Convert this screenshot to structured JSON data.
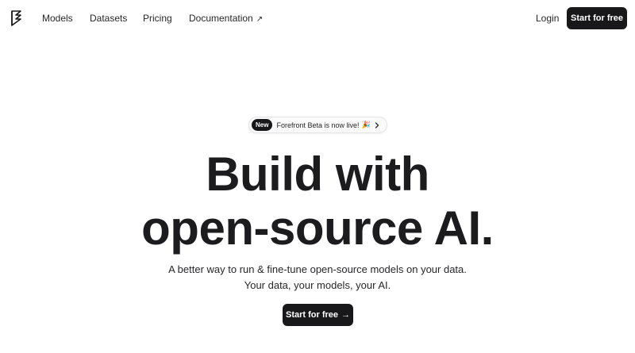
{
  "nav": {
    "links": [
      {
        "label": "Models"
      },
      {
        "label": "Datasets"
      },
      {
        "label": "Pricing"
      },
      {
        "label": "Documentation",
        "external_icon": "arrow-up-right-icon"
      }
    ],
    "login_label": "Login",
    "cta_label": "Start for free"
  },
  "announcement": {
    "badge": "New",
    "text": "Forefront Beta is now live!",
    "emoji": "🎉"
  },
  "hero": {
    "title_line1": "Build with",
    "title_line2": "open-source AI.",
    "subtitle_line1": "A better way to run & fine-tune open-source models on your data.",
    "subtitle_line2": "Your data, your models, your AI.",
    "cta_label": "Start for free",
    "cta_icon": "arrow-right-icon"
  },
  "colors": {
    "primary": "#18181b",
    "background": "#ffffff",
    "text": "#27272a"
  }
}
